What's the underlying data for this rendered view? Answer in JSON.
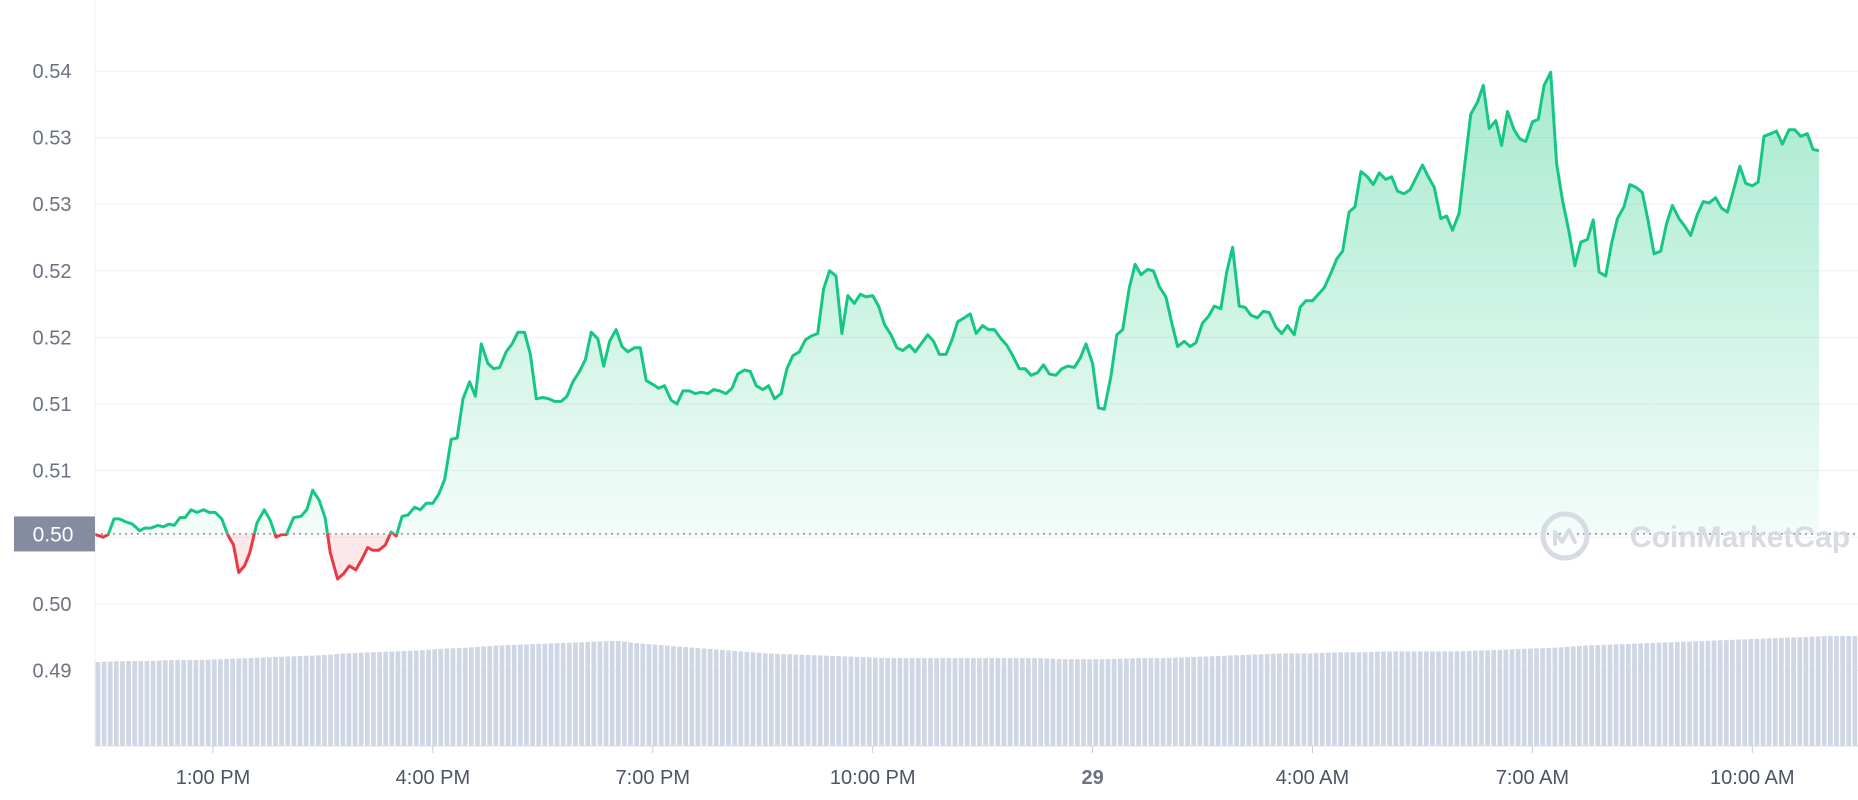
{
  "watermark": "CoinMarketCap",
  "current_price_label": "0.50",
  "colors": {
    "up": "#16c784",
    "down": "#ea3943",
    "volume": "#cfd6e4",
    "grid": "#eef0f3",
    "badge": "#858ca2"
  },
  "chart_data": {
    "type": "line",
    "yticks": [
      "0.54",
      "0.53",
      "0.53",
      "0.52",
      "0.52",
      "0.51",
      "0.51",
      "0.50",
      "0.50",
      "0.49"
    ],
    "ytick_values": [
      0.5394,
      0.5343,
      0.5292,
      0.5241,
      0.519,
      0.5139,
      0.5088,
      0.5037,
      0.4986,
      0.4935
    ],
    "xticks": [
      {
        "label": "1:00 PM",
        "t": 0,
        "bold": false
      },
      {
        "label": "4:00 PM",
        "t": 3,
        "bold": false
      },
      {
        "label": "7:00 PM",
        "t": 6,
        "bold": false
      },
      {
        "label": "10:00 PM",
        "t": 9,
        "bold": false
      },
      {
        "label": "29",
        "t": 12,
        "bold": true
      },
      {
        "label": "4:00 AM",
        "t": 15,
        "bold": false
      },
      {
        "label": "7:00 AM",
        "t": 18,
        "bold": false
      },
      {
        "label": "10:00 AM",
        "t": 21,
        "bold": false
      }
    ],
    "baseline": 0.50395,
    "price": [
      [
        -1.6,
        0.5039
      ],
      [
        -1.5,
        0.5037
      ],
      [
        -1.43,
        0.5039
      ],
      [
        -1.35,
        0.5051
      ],
      [
        -1.28,
        0.5051
      ],
      [
        -1.2,
        0.5049
      ],
      [
        -1.1,
        0.5047
      ],
      [
        -1.0,
        0.5042
      ],
      [
        -0.93,
        0.5044
      ],
      [
        -0.85,
        0.5044
      ],
      [
        -0.75,
        0.5046
      ],
      [
        -0.68,
        0.5045
      ],
      [
        -0.6,
        0.5047
      ],
      [
        -0.53,
        0.5046
      ],
      [
        -0.45,
        0.5052
      ],
      [
        -0.38,
        0.5052
      ],
      [
        -0.3,
        0.5058
      ],
      [
        -0.22,
        0.5056
      ],
      [
        -0.13,
        0.5058
      ],
      [
        -0.05,
        0.5056
      ],
      [
        0.03,
        0.5056
      ],
      [
        0.12,
        0.5051
      ],
      [
        0.2,
        0.5039
      ],
      [
        0.28,
        0.5031
      ],
      [
        0.35,
        0.501
      ],
      [
        0.43,
        0.5015
      ],
      [
        0.5,
        0.5025
      ],
      [
        0.6,
        0.5048
      ],
      [
        0.7,
        0.5058
      ],
      [
        0.78,
        0.505
      ],
      [
        0.86,
        0.5037
      ],
      [
        0.93,
        0.5039
      ],
      [
        1.0,
        0.5039
      ],
      [
        1.1,
        0.5052
      ],
      [
        1.2,
        0.5053
      ],
      [
        1.28,
        0.5058
      ],
      [
        1.36,
        0.5073
      ],
      [
        1.45,
        0.5065
      ],
      [
        1.53,
        0.5052
      ],
      [
        1.6,
        0.5025
      ],
      [
        1.7,
        0.5005
      ],
      [
        1.78,
        0.5009
      ],
      [
        1.86,
        0.5015
      ],
      [
        1.95,
        0.5012
      ],
      [
        2.03,
        0.502
      ],
      [
        2.11,
        0.5029
      ],
      [
        2.18,
        0.5027
      ],
      [
        2.26,
        0.5027
      ],
      [
        2.35,
        0.5031
      ],
      [
        2.43,
        0.5041
      ],
      [
        2.5,
        0.5038
      ],
      [
        2.58,
        0.5053
      ],
      [
        2.66,
        0.5054
      ],
      [
        2.75,
        0.506
      ],
      [
        2.83,
        0.5058
      ],
      [
        2.91,
        0.5063
      ],
      [
        3.0,
        0.5063
      ],
      [
        3.08,
        0.507
      ],
      [
        3.16,
        0.5081
      ],
      [
        3.25,
        0.5112
      ],
      [
        3.33,
        0.5113
      ],
      [
        3.41,
        0.5143
      ],
      [
        3.5,
        0.5156
      ],
      [
        3.58,
        0.5145
      ],
      [
        3.66,
        0.5185
      ],
      [
        3.75,
        0.517
      ],
      [
        3.83,
        0.5166
      ],
      [
        3.91,
        0.5167
      ],
      [
        4.0,
        0.5179
      ],
      [
        4.08,
        0.5185
      ],
      [
        4.16,
        0.5194
      ],
      [
        4.25,
        0.5194
      ],
      [
        4.33,
        0.5177
      ],
      [
        4.41,
        0.5143
      ],
      [
        4.5,
        0.5144
      ],
      [
        4.58,
        0.5143
      ],
      [
        4.66,
        0.5141
      ],
      [
        4.75,
        0.5141
      ],
      [
        4.83,
        0.5145
      ],
      [
        4.91,
        0.5156
      ],
      [
        5.0,
        0.5164
      ],
      [
        5.08,
        0.5173
      ],
      [
        5.16,
        0.5194
      ],
      [
        5.25,
        0.5189
      ],
      [
        5.33,
        0.5168
      ],
      [
        5.41,
        0.5187
      ],
      [
        5.5,
        0.5196
      ],
      [
        5.58,
        0.5183
      ],
      [
        5.66,
        0.5179
      ],
      [
        5.75,
        0.5182
      ],
      [
        5.83,
        0.5182
      ],
      [
        5.91,
        0.5157
      ],
      [
        6.0,
        0.5154
      ],
      [
        6.08,
        0.5151
      ],
      [
        6.16,
        0.5153
      ],
      [
        6.25,
        0.5142
      ],
      [
        6.33,
        0.5139
      ],
      [
        6.41,
        0.5149
      ],
      [
        6.5,
        0.5149
      ],
      [
        6.58,
        0.5147
      ],
      [
        6.66,
        0.5148
      ],
      [
        6.75,
        0.5147
      ],
      [
        6.83,
        0.515
      ],
      [
        6.91,
        0.5149
      ],
      [
        7.0,
        0.5147
      ],
      [
        7.08,
        0.5151
      ],
      [
        7.16,
        0.5162
      ],
      [
        7.25,
        0.5165
      ],
      [
        7.33,
        0.5164
      ],
      [
        7.41,
        0.5153
      ],
      [
        7.5,
        0.515
      ],
      [
        7.58,
        0.5153
      ],
      [
        7.66,
        0.5143
      ],
      [
        7.75,
        0.5147
      ],
      [
        7.83,
        0.5166
      ],
      [
        7.91,
        0.5176
      ],
      [
        8.0,
        0.5179
      ],
      [
        8.08,
        0.5188
      ],
      [
        8.16,
        0.5191
      ],
      [
        8.25,
        0.5193
      ],
      [
        8.33,
        0.5227
      ],
      [
        8.41,
        0.5241
      ],
      [
        8.5,
        0.5237
      ],
      [
        8.58,
        0.5193
      ],
      [
        8.66,
        0.5222
      ],
      [
        8.75,
        0.5216
      ],
      [
        8.83,
        0.5223
      ],
      [
        8.91,
        0.5221
      ],
      [
        9.0,
        0.5222
      ],
      [
        9.08,
        0.5214
      ],
      [
        9.16,
        0.52
      ],
      [
        9.25,
        0.5192
      ],
      [
        9.33,
        0.5182
      ],
      [
        9.41,
        0.518
      ],
      [
        9.5,
        0.5184
      ],
      [
        9.58,
        0.5179
      ],
      [
        9.66,
        0.5185
      ],
      [
        9.75,
        0.5192
      ],
      [
        9.83,
        0.5187
      ],
      [
        9.91,
        0.5177
      ],
      [
        10.0,
        0.5177
      ],
      [
        10.08,
        0.5188
      ],
      [
        10.16,
        0.5202
      ],
      [
        10.25,
        0.5205
      ],
      [
        10.33,
        0.5208
      ],
      [
        10.41,
        0.5193
      ],
      [
        10.5,
        0.5199
      ],
      [
        10.58,
        0.5196
      ],
      [
        10.66,
        0.5196
      ],
      [
        10.75,
        0.5189
      ],
      [
        10.83,
        0.5184
      ],
      [
        10.91,
        0.5176
      ],
      [
        11.0,
        0.5166
      ],
      [
        11.08,
        0.5166
      ],
      [
        11.16,
        0.5161
      ],
      [
        11.25,
        0.5163
      ],
      [
        11.33,
        0.5169
      ],
      [
        11.41,
        0.5162
      ],
      [
        11.5,
        0.5161
      ],
      [
        11.58,
        0.5166
      ],
      [
        11.66,
        0.5168
      ],
      [
        11.75,
        0.5167
      ],
      [
        11.83,
        0.5174
      ],
      [
        11.91,
        0.5185
      ],
      [
        12.0,
        0.517
      ],
      [
        12.08,
        0.5136
      ],
      [
        12.16,
        0.5135
      ],
      [
        12.25,
        0.516
      ],
      [
        12.33,
        0.5192
      ],
      [
        12.41,
        0.5196
      ],
      [
        12.5,
        0.5228
      ],
      [
        12.58,
        0.5246
      ],
      [
        12.66,
        0.5238
      ],
      [
        12.75,
        0.5242
      ],
      [
        12.83,
        0.5241
      ],
      [
        12.91,
        0.5229
      ],
      [
        13.0,
        0.5221
      ],
      [
        13.08,
        0.5201
      ],
      [
        13.16,
        0.5183
      ],
      [
        13.25,
        0.5187
      ],
      [
        13.33,
        0.5183
      ],
      [
        13.41,
        0.5186
      ],
      [
        13.5,
        0.5201
      ],
      [
        13.58,
        0.5206
      ],
      [
        13.66,
        0.5214
      ],
      [
        13.75,
        0.5212
      ],
      [
        13.83,
        0.524
      ],
      [
        13.91,
        0.5259
      ],
      [
        14.0,
        0.5214
      ],
      [
        14.08,
        0.5213
      ],
      [
        14.16,
        0.5207
      ],
      [
        14.25,
        0.5205
      ],
      [
        14.33,
        0.521
      ],
      [
        14.41,
        0.5209
      ],
      [
        14.5,
        0.5198
      ],
      [
        14.58,
        0.5193
      ],
      [
        14.66,
        0.5199
      ],
      [
        14.75,
        0.5192
      ],
      [
        14.83,
        0.5213
      ],
      [
        14.91,
        0.5218
      ],
      [
        15.0,
        0.5218
      ],
      [
        15.08,
        0.5223
      ],
      [
        15.16,
        0.5228
      ],
      [
        15.25,
        0.5239
      ],
      [
        15.33,
        0.525
      ],
      [
        15.41,
        0.5256
      ],
      [
        15.5,
        0.5286
      ],
      [
        15.58,
        0.529
      ],
      [
        15.66,
        0.5317
      ],
      [
        15.75,
        0.5313
      ],
      [
        15.83,
        0.5307
      ],
      [
        15.91,
        0.5316
      ],
      [
        16.0,
        0.5311
      ],
      [
        16.08,
        0.5313
      ],
      [
        16.16,
        0.5302
      ],
      [
        16.25,
        0.53
      ],
      [
        16.33,
        0.5303
      ],
      [
        16.41,
        0.5312
      ],
      [
        16.5,
        0.5322
      ],
      [
        16.58,
        0.5313
      ],
      [
        16.66,
        0.5305
      ],
      [
        16.75,
        0.5281
      ],
      [
        16.83,
        0.5283
      ],
      [
        16.91,
        0.5272
      ],
      [
        17.0,
        0.5285
      ],
      [
        17.08,
        0.5324
      ],
      [
        17.16,
        0.5361
      ],
      [
        17.25,
        0.537
      ],
      [
        17.33,
        0.5383
      ],
      [
        17.41,
        0.535
      ],
      [
        17.5,
        0.5356
      ],
      [
        17.58,
        0.5337
      ],
      [
        17.66,
        0.5363
      ],
      [
        17.75,
        0.5349
      ],
      [
        17.83,
        0.5342
      ],
      [
        17.91,
        0.534
      ],
      [
        18.0,
        0.5355
      ],
      [
        18.08,
        0.5357
      ],
      [
        18.16,
        0.5383
      ],
      [
        18.25,
        0.5393
      ],
      [
        18.33,
        0.5323
      ],
      [
        18.41,
        0.5295
      ],
      [
        18.5,
        0.5271
      ],
      [
        18.58,
        0.5245
      ],
      [
        18.66,
        0.5263
      ],
      [
        18.75,
        0.5265
      ],
      [
        18.83,
        0.528
      ],
      [
        18.91,
        0.524
      ],
      [
        19.0,
        0.5237
      ],
      [
        19.08,
        0.5262
      ],
      [
        19.16,
        0.5281
      ],
      [
        19.25,
        0.529
      ],
      [
        19.33,
        0.5307
      ],
      [
        19.41,
        0.5305
      ],
      [
        19.5,
        0.5301
      ],
      [
        19.58,
        0.5279
      ],
      [
        19.66,
        0.5254
      ],
      [
        19.75,
        0.5256
      ],
      [
        19.83,
        0.5277
      ],
      [
        19.91,
        0.5291
      ],
      [
        20.0,
        0.5281
      ],
      [
        20.08,
        0.5275
      ],
      [
        20.16,
        0.5268
      ],
      [
        20.25,
        0.5284
      ],
      [
        20.33,
        0.5294
      ],
      [
        20.41,
        0.5293
      ],
      [
        20.5,
        0.5297
      ],
      [
        20.58,
        0.5289
      ],
      [
        20.66,
        0.5286
      ],
      [
        20.75,
        0.5304
      ],
      [
        20.83,
        0.5321
      ],
      [
        20.91,
        0.5308
      ],
      [
        21.0,
        0.5306
      ],
      [
        21.08,
        0.5309
      ],
      [
        21.16,
        0.5344
      ],
      [
        21.25,
        0.5346
      ],
      [
        21.33,
        0.5348
      ],
      [
        21.41,
        0.5338
      ],
      [
        21.5,
        0.5349
      ],
      [
        21.58,
        0.5349
      ],
      [
        21.66,
        0.5344
      ],
      [
        21.75,
        0.5346
      ],
      [
        21.83,
        0.5334
      ],
      [
        21.91,
        0.5333
      ]
    ],
    "volume_range": [
      0.0,
      1.0
    ],
    "volume": [
      0.78,
      0.79,
      0.79,
      0.8,
      0.8,
      0.81,
      0.82,
      0.83,
      0.84,
      0.85,
      0.87,
      0.88,
      0.89,
      0.9,
      0.92,
      0.93,
      0.95,
      0.96,
      0.97,
      0.98,
      0.99,
      1.0,
      0.97,
      0.95,
      0.93,
      0.91,
      0.89,
      0.87,
      0.86,
      0.85,
      0.84,
      0.83,
      0.82,
      0.82,
      0.82,
      0.82,
      0.82,
      0.82,
      0.82,
      0.81,
      0.81,
      0.81,
      0.82,
      0.82,
      0.83,
      0.84,
      0.85,
      0.86,
      0.87,
      0.87,
      0.88,
      0.88,
      0.89,
      0.89,
      0.89,
      0.89,
      0.9,
      0.91,
      0.92,
      0.93,
      0.95,
      0.96,
      0.97,
      0.98,
      0.99,
      1.0,
      1.01,
      1.02,
      1.03,
      1.04,
      1.05,
      1.05
    ]
  }
}
